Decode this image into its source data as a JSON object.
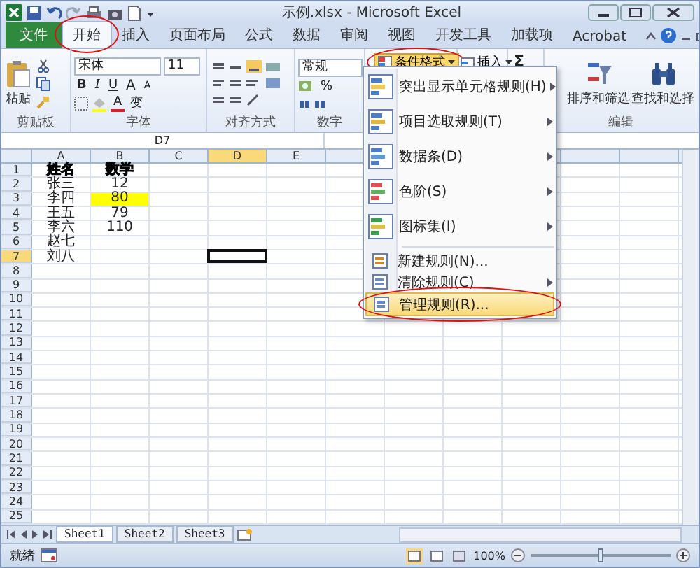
{
  "window": {
    "title": "示例.xlsx - Microsoft Excel"
  },
  "tabs": [
    {
      "label": "文件",
      "kind": "file",
      "selected": false,
      "circled": false
    },
    {
      "label": "开始",
      "kind": "tab",
      "selected": true,
      "circled": true
    },
    {
      "label": "插入",
      "kind": "tab",
      "selected": false,
      "circled": false
    },
    {
      "label": "页面布局",
      "kind": "tab",
      "selected": false,
      "circled": false
    },
    {
      "label": "公式",
      "kind": "tab",
      "selected": false,
      "circled": false
    },
    {
      "label": "数据",
      "kind": "tab",
      "selected": false,
      "circled": false
    },
    {
      "label": "审阅",
      "kind": "tab",
      "selected": false,
      "circled": false
    },
    {
      "label": "视图",
      "kind": "tab",
      "selected": false,
      "circled": false
    },
    {
      "label": "开发工具",
      "kind": "tab",
      "selected": false,
      "circled": false
    },
    {
      "label": "加载项",
      "kind": "tab",
      "selected": false,
      "circled": false
    },
    {
      "label": "Acrobat",
      "kind": "tab",
      "selected": false,
      "circled": false
    }
  ],
  "ribbon": {
    "clipboard": {
      "paste": "粘贴",
      "label": "剪贴板"
    },
    "font": {
      "name": "宋体",
      "size": "11",
      "bold": "B",
      "italic": "I",
      "underline": "U",
      "grow": "A",
      "shrink": "A",
      "font_color": "A",
      "phonetic": "变",
      "label": "字体"
    },
    "alignment": {
      "label": "对齐方式"
    },
    "number": {
      "format": "常规",
      "percent": "%",
      "label": "数字"
    },
    "conditional_format": {
      "label": "条件格式",
      "circled": true,
      "expanded": true
    },
    "cells": {
      "insert": "插入"
    },
    "editing": {
      "sum": "Σ",
      "sort": "排序和筛选",
      "find": "查找和选择",
      "label": "编辑"
    }
  },
  "formula_bar": {
    "name_box": "D7"
  },
  "columns": [
    {
      "label": "A",
      "selected": false
    },
    {
      "label": "B",
      "selected": false
    },
    {
      "label": "C",
      "selected": false
    },
    {
      "label": "D",
      "selected": true
    },
    {
      "label": "E",
      "selected": false
    }
  ],
  "rows": [
    {
      "number": "1",
      "selected": false,
      "bold": true,
      "cells": [
        {
          "text": "姓名"
        },
        {
          "text": "数学"
        }
      ]
    },
    {
      "number": "2",
      "selected": false,
      "bold": false,
      "cells": [
        {
          "text": "张三"
        },
        {
          "text": "12"
        }
      ]
    },
    {
      "number": "3",
      "selected": false,
      "bold": false,
      "cells": [
        {
          "text": "李四"
        },
        {
          "text": "80",
          "color": "#ffff00"
        }
      ]
    },
    {
      "number": "4",
      "selected": false,
      "bold": false,
      "cells": [
        {
          "text": "王五"
        },
        {
          "text": "79"
        }
      ]
    },
    {
      "number": "5",
      "selected": false,
      "bold": false,
      "cells": [
        {
          "text": "李六"
        },
        {
          "text": "110"
        }
      ]
    },
    {
      "number": "6",
      "selected": false,
      "bold": false,
      "cells": [
        {
          "text": "赵七"
        }
      ]
    },
    {
      "number": "7",
      "selected": true,
      "bold": false,
      "cells": [
        {
          "text": "刘八"
        }
      ]
    },
    {
      "number": "8",
      "selected": false
    },
    {
      "number": "9",
      "selected": false
    },
    {
      "number": "10",
      "selected": false
    },
    {
      "number": "11",
      "selected": false
    },
    {
      "number": "12",
      "selected": false
    },
    {
      "number": "13",
      "selected": false
    },
    {
      "number": "14",
      "selected": false
    },
    {
      "number": "15",
      "selected": false
    },
    {
      "number": "16",
      "selected": false
    },
    {
      "number": "17",
      "selected": false
    },
    {
      "number": "18",
      "selected": false
    },
    {
      "number": "19",
      "selected": false
    },
    {
      "number": "20",
      "selected": false
    },
    {
      "number": "21",
      "selected": false
    },
    {
      "number": "22",
      "selected": false
    },
    {
      "number": "23",
      "selected": false
    },
    {
      "number": "24",
      "selected": false
    },
    {
      "number": "25",
      "selected": false
    }
  ],
  "menu": {
    "items": [
      {
        "kind": "large",
        "label": "突出显示单元格规则(H)",
        "submenu": true,
        "selected": false,
        "circled": false
      },
      {
        "kind": "large",
        "label": "项目选取规则(T)",
        "submenu": true,
        "selected": false,
        "circled": false
      },
      {
        "kind": "large",
        "label": "数据条(D)",
        "submenu": true,
        "selected": false,
        "circled": false
      },
      {
        "kind": "large",
        "label": "色阶(S)",
        "submenu": true,
        "selected": false,
        "circled": false
      },
      {
        "kind": "large",
        "label": "图标集(I)",
        "submenu": true,
        "selected": false,
        "circled": false
      },
      {
        "kind": "small",
        "label": "新建规则(N)...",
        "submenu": false,
        "selected": false,
        "circled": false
      },
      {
        "kind": "small",
        "label": "清除规则(C)",
        "submenu": true,
        "selected": false,
        "circled": false
      },
      {
        "kind": "small",
        "label": "管理规则(R)...",
        "submenu": false,
        "selected": true,
        "circled": true
      }
    ]
  },
  "sheets": [
    {
      "label": "Sheet1",
      "selected": true
    },
    {
      "label": "Sheet2",
      "selected": false
    },
    {
      "label": "Sheet3",
      "selected": false
    }
  ],
  "status_bar": {
    "text": "就绪",
    "zoom": "100%",
    "zoom_slider": {
      "level": 0.5
    }
  }
}
